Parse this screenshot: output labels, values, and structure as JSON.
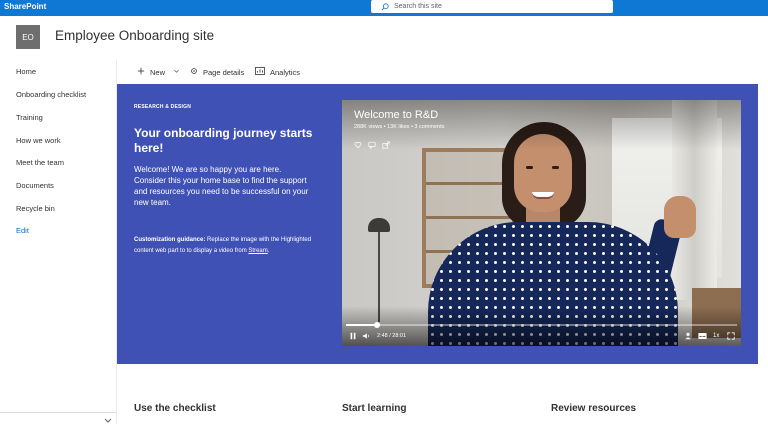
{
  "suite_bar": {
    "brand": "SharePoint",
    "search_placeholder": "Search this site",
    "color": "#0f78d4"
  },
  "site": {
    "logo_initials": "EO",
    "title": "Employee Onboarding site"
  },
  "left_nav": {
    "items": [
      {
        "label": "Home"
      },
      {
        "label": "Onboarding checklist"
      },
      {
        "label": "Training"
      },
      {
        "label": "How we work"
      },
      {
        "label": "Meet the team"
      },
      {
        "label": "Documents"
      },
      {
        "label": "Recycle bin"
      }
    ],
    "edit_label": "Edit"
  },
  "command_bar": {
    "new_label": "New",
    "page_details_label": "Page details",
    "analytics_label": "Analytics"
  },
  "hero": {
    "eyebrow": "RESEARCH & DESIGN",
    "heading": "Your onboarding journey starts here!",
    "body": "Welcome! We are so happy you are here. Consider this your home base to find the support and resources you need to be successful on your new team.",
    "guidance_label": "Customization guidance:",
    "guidance_text": " Replace the image with the Highlighted content web part to to display a video from ",
    "guidance_link": "Stream",
    "guidance_end": ".",
    "band_color": "#4051b5"
  },
  "video": {
    "title": "Welcome to R&D",
    "meta": "288K views • 13K likes • 3 comments",
    "time": "2:48 / 28:01",
    "speed": "1x",
    "progress": 0.08
  },
  "sections": {
    "checklist": "Use the checklist",
    "learning": "Start learning",
    "resources": "Review resources"
  }
}
